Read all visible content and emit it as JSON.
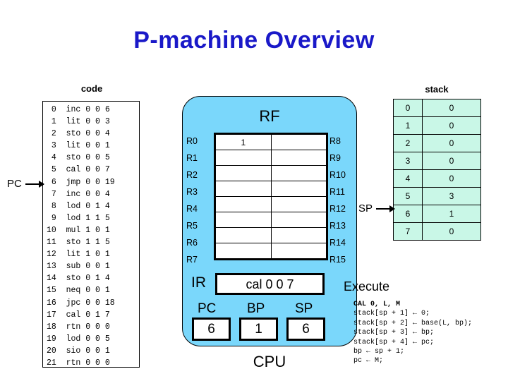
{
  "title": "P-machine Overview",
  "code_panel": {
    "heading": "code",
    "pointer_label": "PC",
    "pointer_row_index": 6,
    "lines": [
      " 0  inc 0 0 6",
      " 1  lit 0 0 3",
      " 2  sto 0 0 4",
      " 3  lit 0 0 1",
      " 4  sto 0 0 5",
      " 5  cal 0 0 7",
      " 6  jmp 0 0 19",
      " 7  inc 0 0 4",
      " 8  lod 0 1 4",
      " 9  lod 1 1 5",
      "10  mul 1 0 1",
      "11  sto 1 1 5",
      "12  lit 1 0 1",
      "13  sub 0 0 1",
      "14  sto 0 1 4",
      "15  neq 0 0 1",
      "16  jpc 0 0 18",
      "17  cal 0 1 7",
      "18  rtn 0 0 0",
      "19  lod 0 0 5",
      "20  sio 0 0 1",
      "21  rtn 0 0 0"
    ]
  },
  "cpu": {
    "caption": "CPU",
    "rf_title": "RF",
    "rf_left_labels": [
      "R0",
      "R1",
      "R2",
      "R3",
      "R4",
      "R5",
      "R6",
      "R7"
    ],
    "rf_right_labels": [
      "R8",
      "R9",
      "R10",
      "R11",
      "R12",
      "R13",
      "R14",
      "R15"
    ],
    "rf_left_values": [
      "1",
      "",
      "",
      "",
      "",
      "",
      "",
      ""
    ],
    "rf_right_values": [
      "",
      "",
      "",
      "",
      "",
      "",
      "",
      ""
    ],
    "ir_label": "IR",
    "ir_value": "cal 0 0 7",
    "pc_label": "PC",
    "pc_value": "6",
    "bp_label": "BP",
    "bp_value": "1",
    "sp_label": "SP",
    "sp_value": "6"
  },
  "stack": {
    "heading": "stack",
    "pointer_label": "SP",
    "pointer_row_index": 6,
    "rows": [
      {
        "index": "0",
        "value": "0"
      },
      {
        "index": "1",
        "value": "0"
      },
      {
        "index": "2",
        "value": "0"
      },
      {
        "index": "3",
        "value": "0"
      },
      {
        "index": "4",
        "value": "0"
      },
      {
        "index": "5",
        "value": "3"
      },
      {
        "index": "6",
        "value": "1"
      },
      {
        "index": "7",
        "value": "0"
      }
    ]
  },
  "execute": {
    "heading": "Execute",
    "lines": [
      {
        "text": "CAL 0, L, M",
        "bold": true
      },
      {
        "text": "stack[sp + 1] ← 0;",
        "bold": false
      },
      {
        "text": "stack[sp + 2] ← base(L, bp);",
        "bold": false
      },
      {
        "text": "stack[sp + 3] ← bp;",
        "bold": false
      },
      {
        "text": "stack[sp + 4] ← pc;",
        "bold": false
      },
      {
        "text": "bp ← sp + 1;",
        "bold": false
      },
      {
        "text": "pc ← M;",
        "bold": false
      }
    ]
  },
  "colors": {
    "title": "#1a19c8",
    "cpu_background": "#7ad7fb",
    "stack_cell": "#c9f7e7",
    "register_cell": "#ffffff",
    "border": "#000000"
  }
}
